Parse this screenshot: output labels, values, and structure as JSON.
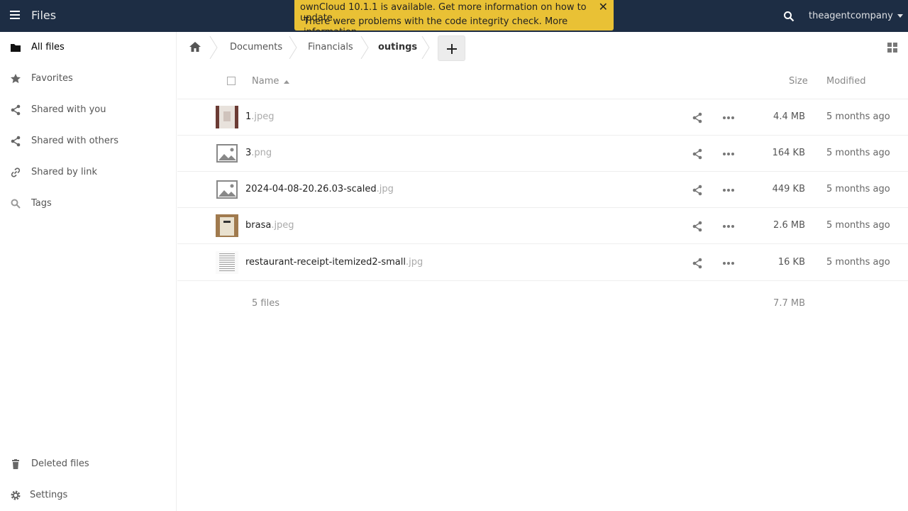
{
  "app": {
    "title": "Files"
  },
  "header": {
    "user": "theagentcompany"
  },
  "notification": {
    "line1": "ownCloud 10.1.1 is available. Get more information on how to update.",
    "line2": "There were problems with the code integrity check. More information…"
  },
  "sidebar": {
    "items": [
      {
        "label": "All files",
        "icon": "folder-icon"
      },
      {
        "label": "Favorites",
        "icon": "star-icon"
      },
      {
        "label": "Shared with you",
        "icon": "share-icon"
      },
      {
        "label": "Shared with others",
        "icon": "share-icon"
      },
      {
        "label": "Shared by link",
        "icon": "link-icon"
      },
      {
        "label": "Tags",
        "icon": "tag-icon"
      }
    ],
    "bottom": [
      {
        "label": "Deleted files",
        "icon": "trash-icon"
      },
      {
        "label": "Settings",
        "icon": "gear-icon"
      }
    ]
  },
  "breadcrumb": [
    "Documents",
    "Financials",
    "outings"
  ],
  "table": {
    "headers": {
      "name": "Name",
      "size": "Size",
      "modified": "Modified"
    },
    "rows": [
      {
        "base": "1",
        "ext": ".jpeg",
        "size": "4.4 MB",
        "modified": "5 months ago"
      },
      {
        "base": "3",
        "ext": ".png",
        "size": "164 KB",
        "modified": "5 months ago"
      },
      {
        "base": "2024-04-08-20.26.03-scaled",
        "ext": ".jpg",
        "size": "449 KB",
        "modified": "5 months ago"
      },
      {
        "base": "brasa",
        "ext": ".jpeg",
        "size": "2.6 MB",
        "modified": "5 months ago"
      },
      {
        "base": "restaurant-receipt-itemized2-small",
        "ext": ".jpg",
        "size": "16 KB",
        "modified": "5 months ago"
      }
    ],
    "summary": {
      "count": "5 files",
      "size": "7.7 MB"
    }
  },
  "colors": {
    "header_bg": "#1d2d44",
    "notification_bg": "#e9c135"
  }
}
